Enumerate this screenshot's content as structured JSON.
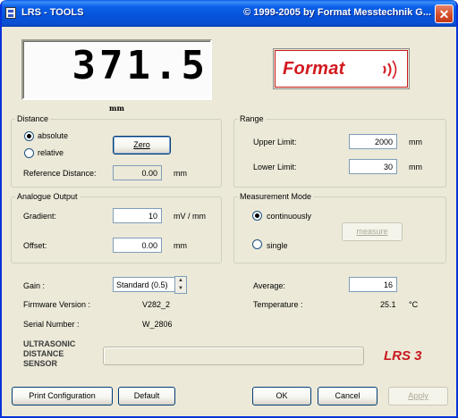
{
  "window": {
    "title_left": "LRS - TOOLS",
    "title_right": "© 1999-2005 by Format Messtechnik G...",
    "close_glyph": "✕"
  },
  "display": {
    "value": "371.5",
    "unit": "mm"
  },
  "logo": {
    "text": "Format"
  },
  "distance": {
    "legend": "Distance",
    "options": [
      "absolute",
      "relative"
    ],
    "selected": "absolute",
    "zero_button": "Zero",
    "reference_label": "Reference Distance:",
    "reference_value": "0.00",
    "reference_unit": "mm"
  },
  "range": {
    "legend": "Range",
    "upper_label": "Upper Limit:",
    "upper_value": "2000",
    "upper_unit": "mm",
    "lower_label": "Lower Limit:",
    "lower_value": "30",
    "lower_unit": "mm"
  },
  "analogue": {
    "legend": "Analogue Output",
    "gradient_label": "Gradient:",
    "gradient_value": "10",
    "gradient_unit": "mV / mm",
    "offset_label": "Offset:",
    "offset_value": "0.00",
    "offset_unit": "mm"
  },
  "mode": {
    "legend": "Measurement Mode",
    "options": [
      "continuously",
      "single"
    ],
    "selected": "continuously",
    "measure_button": "measure"
  },
  "info": {
    "gain_label": "Gain :",
    "gain_value": "Standard (0.5)",
    "firmware_label": "Firmware Version :",
    "firmware_value": "V282_2",
    "serial_label": "Serial Number :",
    "serial_value": "W_2806",
    "average_label": "Average:",
    "average_value": "16",
    "temperature_label": "Temperature :",
    "temperature_value": "25.1",
    "temperature_unit": "°C"
  },
  "product": {
    "line1": "ULTRASONIC",
    "line2": "DISTANCE",
    "line3": "SENSOR",
    "model": "LRS 3"
  },
  "buttons": {
    "print": "Print Configuration",
    "default": "Default",
    "ok": "OK",
    "cancel": "Cancel",
    "apply": "Apply"
  },
  "colors": {
    "accent_red": "#d3191f",
    "title_blue": "#0553db"
  }
}
